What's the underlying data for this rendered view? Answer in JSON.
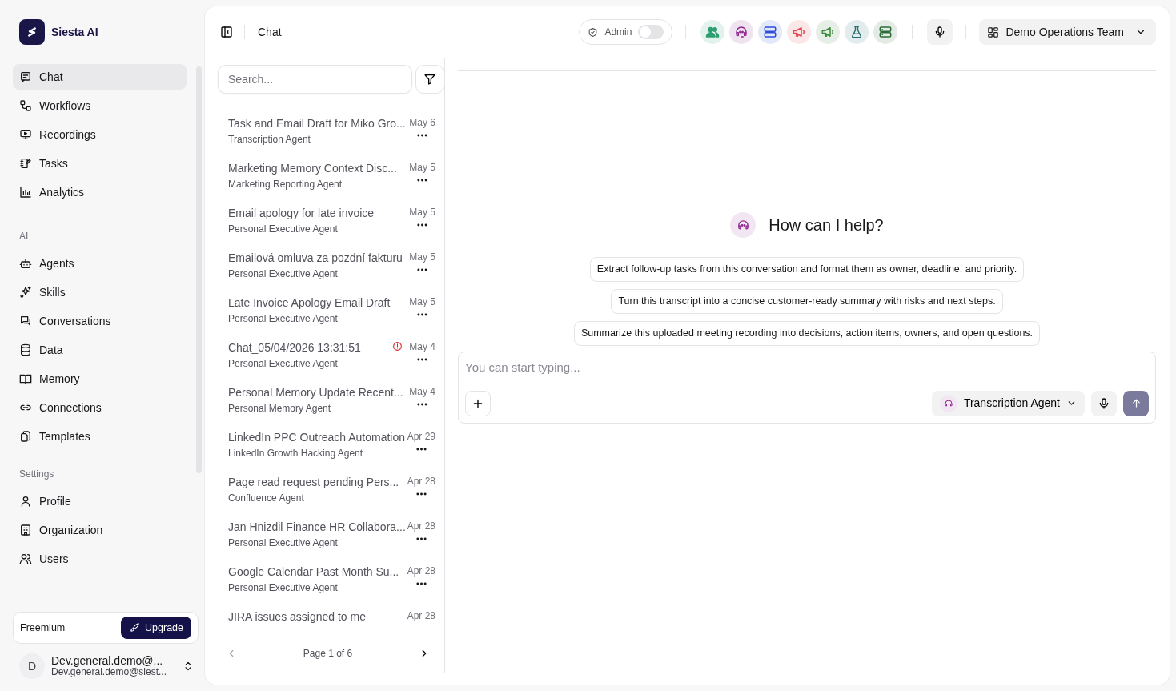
{
  "app": {
    "name": "Siesta AI"
  },
  "sidebar": {
    "sections": [
      {
        "items": [
          {
            "label": "Chat",
            "selected": true
          },
          {
            "label": "Workflows",
            "selected": false
          },
          {
            "label": "Recordings",
            "selected": false
          },
          {
            "label": "Tasks",
            "selected": false
          },
          {
            "label": "Analytics",
            "selected": false
          }
        ]
      },
      {
        "label": "AI",
        "items": [
          {
            "label": "Agents",
            "selected": false
          },
          {
            "label": "Skills",
            "selected": false
          },
          {
            "label": "Conversations",
            "selected": false
          },
          {
            "label": "Data",
            "selected": false
          },
          {
            "label": "Memory",
            "selected": false
          },
          {
            "label": "Connections",
            "selected": false
          },
          {
            "label": "Templates",
            "selected": false
          }
        ]
      },
      {
        "label": "Settings",
        "items": [
          {
            "label": "Profile",
            "selected": false
          },
          {
            "label": "Organization",
            "selected": false
          },
          {
            "label": "Users",
            "selected": false
          }
        ]
      }
    ],
    "plan": {
      "label": "Freemium",
      "button": "Upgrade"
    },
    "user": {
      "initial": "D",
      "name": "Dev.general.demo@...",
      "email": "Dev.general.demo@siest..."
    }
  },
  "header": {
    "title": "Chat",
    "admin": {
      "label": "Admin",
      "on": false
    },
    "agents": [
      {
        "color": "#2f9e72"
      },
      {
        "color": "#8e2a8e"
      },
      {
        "color": "#2d4fd6"
      },
      {
        "color": "#e2474f"
      },
      {
        "color": "#3f8a3a"
      },
      {
        "color": "#2b6f73"
      },
      {
        "color": "#2e6b3a"
      }
    ],
    "team": "Demo Operations Team"
  },
  "chat_list": {
    "search": {
      "placeholder": "Search..."
    },
    "items": [
      {
        "title": "Task and Email Draft for Miko Gro...",
        "agent": "Transcription Agent",
        "date": "May 6",
        "error": false
      },
      {
        "title": "Marketing Memory Context Disc...",
        "agent": "Marketing Reporting Agent",
        "date": "May 5",
        "error": false
      },
      {
        "title": "Email apology for late invoice",
        "agent": "Personal Executive Agent",
        "date": "May 5",
        "error": false
      },
      {
        "title": "Emailová omluva za pozdní fakturu",
        "agent": "Personal Executive Agent",
        "date": "May 5",
        "error": false
      },
      {
        "title": "Late Invoice Apology Email Draft",
        "agent": "Personal Executive Agent",
        "date": "May 5",
        "error": false
      },
      {
        "title": "Chat_05/04/2026 13:31:51",
        "agent": "Personal Executive Agent",
        "date": "May 4",
        "error": true
      },
      {
        "title": "Personal Memory Update Recent...",
        "agent": "Personal Memory Agent",
        "date": "May 4",
        "error": false
      },
      {
        "title": "LinkedIn PPC Outreach Automation",
        "agent": "LinkedIn Growth Hacking Agent",
        "date": "Apr 29",
        "error": false
      },
      {
        "title": "Page read request pending Pers...",
        "agent": "Confluence Agent",
        "date": "Apr 28",
        "error": false
      },
      {
        "title": "Jan Hnizdil Finance HR Collabora...",
        "agent": "Personal Executive Agent",
        "date": "Apr 28",
        "error": false
      },
      {
        "title": "Google Calendar Past Month Su...",
        "agent": "Personal Executive Agent",
        "date": "Apr 28",
        "error": false
      },
      {
        "title": "JIRA issues assigned to me",
        "date": "Apr 28",
        "error": false
      }
    ],
    "pager": "Page 1 of 6"
  },
  "chat": {
    "greeting": "How can I help?",
    "suggestions": [
      "Extract follow-up tasks from this conversation and format them as owner, deadline, and priority.",
      "Turn this transcript into a concise customer-ready summary with risks and next steps.",
      "Summarize this uploaded meeting recording into decisions, action items, owners, and open questions."
    ],
    "input": {
      "placeholder": "You can start typing..."
    },
    "agent": "Transcription Agent"
  }
}
